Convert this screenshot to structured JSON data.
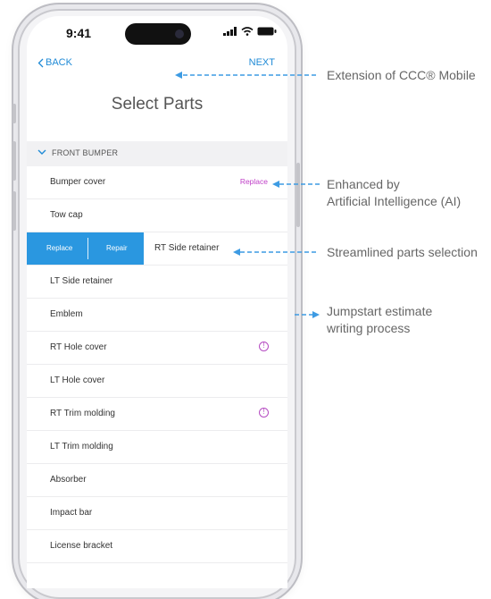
{
  "status_bar": {
    "time": "9:41"
  },
  "nav": {
    "back": "BACK",
    "next": "NEXT"
  },
  "title": "Select Parts",
  "section": {
    "label": "FRONT BUMPER"
  },
  "swipe_actions": {
    "replace": "Replace",
    "repair": "Repair"
  },
  "parts": [
    {
      "name": "Bumper cover",
      "action": "Replace"
    },
    {
      "name": "Tow cap"
    },
    {
      "name": "RT Side retainer",
      "swiped": true
    },
    {
      "name": "LT Side retainer"
    },
    {
      "name": "Emblem"
    },
    {
      "name": "RT Hole cover",
      "alert": true
    },
    {
      "name": "LT Hole cover"
    },
    {
      "name": "RT Trim molding",
      "alert": true
    },
    {
      "name": "LT Trim molding"
    },
    {
      "name": "Absorber"
    },
    {
      "name": "Impact bar"
    },
    {
      "name": "License bracket"
    }
  ],
  "annotations": {
    "a1": "Extension of CCC® Mobile",
    "a2_line1": "Enhanced by",
    "a2_line2": "Artificial Intelligence (AI)",
    "a3": "Streamlined parts selection",
    "a4_line1": "Jumpstart estimate",
    "a4_line2": "writing process"
  },
  "colors": {
    "accent": "#1f8ad6",
    "swipe": "#2a97e0",
    "ai": "#c040c8",
    "annotation_arrow": "#3d9be3"
  }
}
